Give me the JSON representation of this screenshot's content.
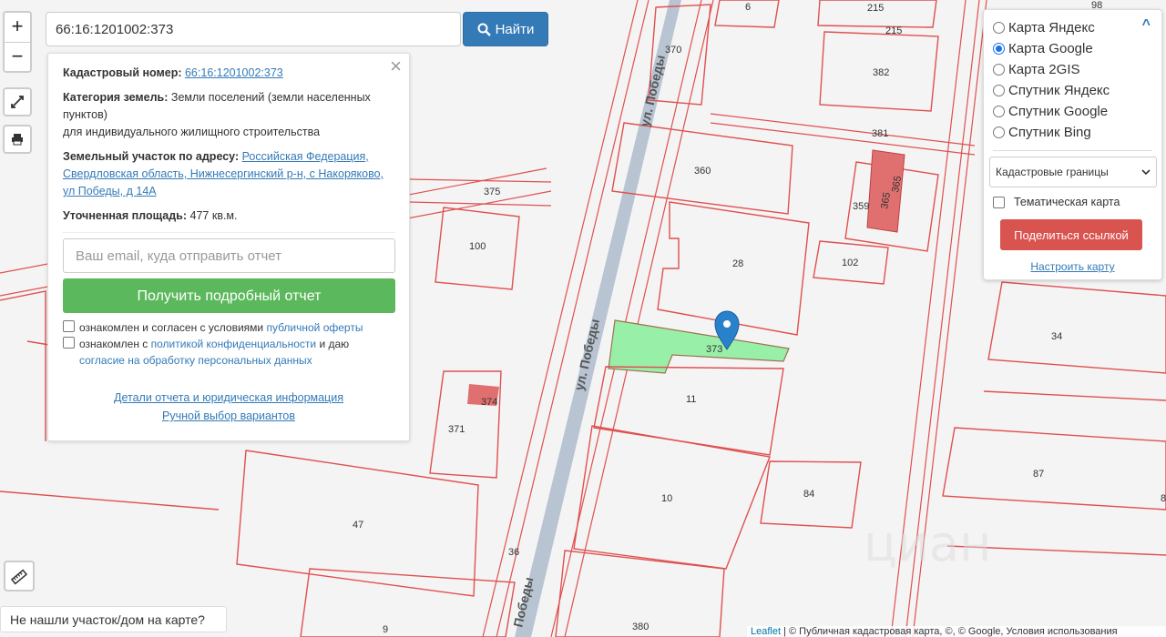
{
  "search": {
    "value": "66:16:1201002:373",
    "button_label": "Найти"
  },
  "zoom": {
    "in_label": "+",
    "out_label": "−"
  },
  "info_panel": {
    "cadastral_label": "Кадастровый номер:",
    "cadastral_value": "66:16:1201002:373",
    "category_label": "Категория земель:",
    "category_value_1": "Земли поселений (земли населенных пунктов)",
    "category_value_2": "для индивидуального жилищного строительства",
    "address_label": "Земельный участок по адресу:",
    "address_value": "Российская Федерация, Свердловская область, Нижнесергинский р-н, с Накоряково, ул Победы, д 14А",
    "area_label": "Уточненная площадь:",
    "area_value": "477 кв.м.",
    "email_placeholder": "Ваш email, куда отправить отчет",
    "report_button": "Получить подробный отчет",
    "consent1_text": "ознакомлен и согласен с условиями",
    "consent1_link": "публичной оферты",
    "consent2_text": "ознакомлен с",
    "consent2_link": "политикой конфиденциальности",
    "consent2_mid": "и даю",
    "consent2_link2": "согласие на обработку персональных данных",
    "details_link": "Детали отчета и юридическая информация",
    "manual_link": "Ручной выбор вариантов"
  },
  "layers": {
    "options": [
      {
        "label": "Карта Яндекс",
        "selected": false
      },
      {
        "label": "Карта Google",
        "selected": true
      },
      {
        "label": "Карта 2GIS",
        "selected": false
      },
      {
        "label": "Спутник Яндекс",
        "selected": false
      },
      {
        "label": "Спутник Google",
        "selected": false
      },
      {
        "label": "Спутник Bing",
        "selected": false
      }
    ],
    "select_value": "Кадастровые границы",
    "thematic_label": "Тематическая карта",
    "share_button": "Поделиться ссылкой",
    "configure_link": "Настроить карту"
  },
  "not_found": "Не нашли участок/дом на карте?",
  "attribution": {
    "leaflet": "Leaflet",
    "rest": "| © Публичная кадастровая карта, ©, © Google, Условия использования"
  },
  "watermark": "циан",
  "map": {
    "street_label": "ул. Победы",
    "street_label_2": "Победы",
    "parcel_labels": [
      "6",
      "215",
      "215",
      "98",
      "370",
      "382",
      "381",
      "360",
      "359",
      "365",
      "365",
      "375",
      "100",
      "28",
      "102",
      "373",
      "34",
      "374",
      "11",
      "371",
      "87",
      "10",
      "84",
      "47",
      "36",
      "380",
      "9",
      "8"
    ]
  }
}
